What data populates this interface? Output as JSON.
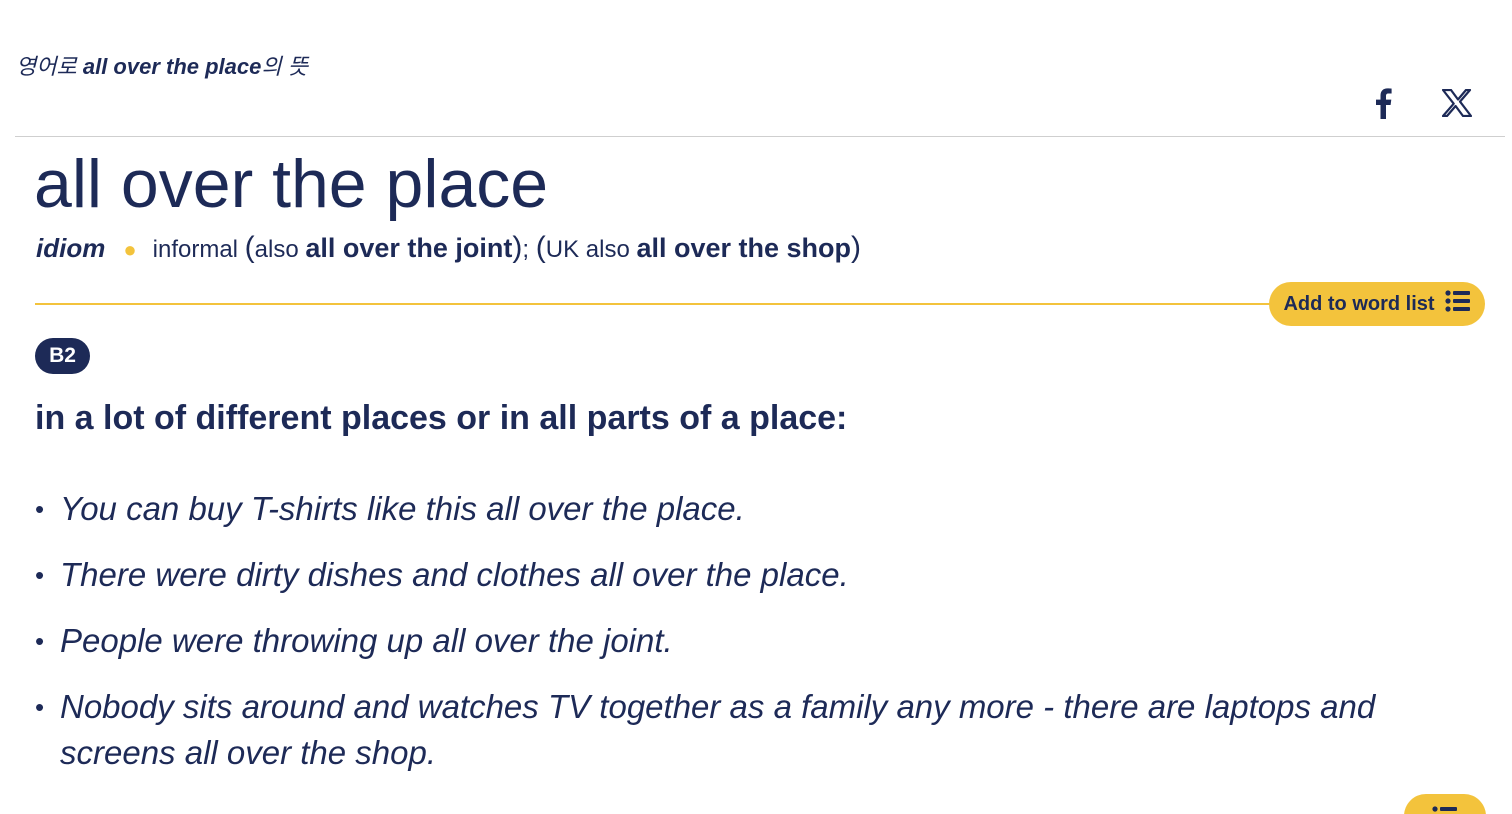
{
  "heading": {
    "prefix": "영어로 ",
    "headword": "all over the place",
    "suffix": "의 뜻"
  },
  "share": {
    "facebook_icon": "facebook-icon",
    "x_icon": "x-twitter-icon"
  },
  "entry": {
    "headword": "all over the place",
    "pos": "idiom",
    "label": "informal",
    "also_label": "also",
    "variant1": "all over the joint",
    "sep": ";",
    "region": "UK",
    "also_label2": "also",
    "variant2": "all over the shop"
  },
  "word_list_button": {
    "label": "Add to word list",
    "icon": "list-icon"
  },
  "sense": {
    "level": "B2",
    "definition": "in a lot of different places or in all parts of a place:",
    "examples": [
      "You can buy T-shirts like this all over the place.",
      "There were dirty dishes and clothes all over the place.",
      "People were throwing up all over the joint.",
      "Nobody sits around and watches TV together as a family any more - there are laptops and screens all over the shop."
    ]
  },
  "colors": {
    "navy": "#1d2a57",
    "accent_yellow": "#f3c33c",
    "divider": "#cfcfcf"
  }
}
